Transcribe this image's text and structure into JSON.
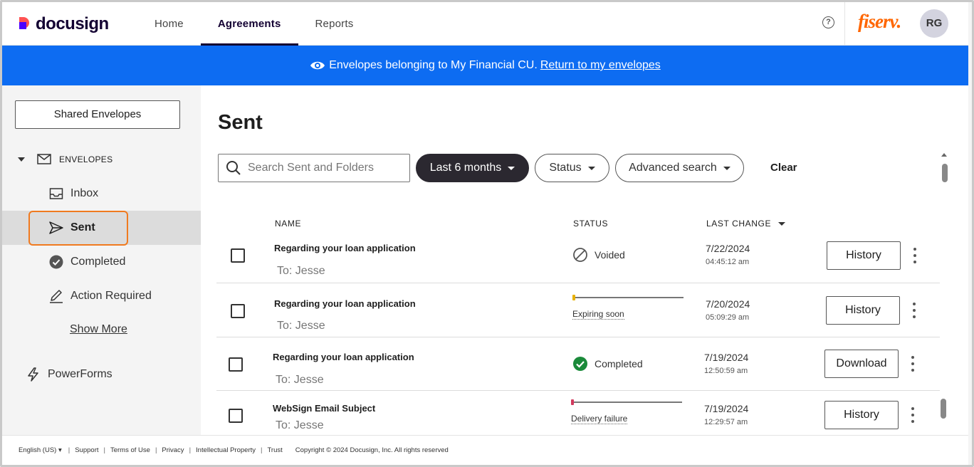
{
  "header": {
    "logo": "docusign",
    "nav": [
      "Home",
      "Agreements",
      "Reports"
    ],
    "active_nav": "Agreements",
    "brand": "fiserv.",
    "avatar": "RG",
    "help": "?"
  },
  "banner": {
    "text": "Envelopes belonging to My Financial CU.",
    "link": "Return to my envelopes"
  },
  "sidebar": {
    "shared_button": "Shared Envelopes",
    "section": "ENVELOPES",
    "items": [
      {
        "label": "Inbox",
        "icon": "inbox-icon"
      },
      {
        "label": "Sent",
        "icon": "send-icon"
      },
      {
        "label": "Completed",
        "icon": "check-circle-icon"
      },
      {
        "label": "Action Required",
        "icon": "pen-icon"
      }
    ],
    "show_more": "Show More",
    "powerforms": "PowerForms"
  },
  "main": {
    "title": "Sent",
    "search_placeholder": "Search Sent and Folders",
    "filters": {
      "date": "Last 6 months",
      "status": "Status",
      "advanced": "Advanced search",
      "clear": "Clear"
    },
    "columns": {
      "name": "NAME",
      "status": "STATUS",
      "last_change": "LAST CHANGE"
    },
    "rows": [
      {
        "subject": "Regarding your loan application",
        "to": "To: Jesse",
        "status": "Voided",
        "date": "7/22/2024",
        "time": "04:45:12 am",
        "action": "History"
      },
      {
        "subject": "Regarding your loan application",
        "to": "To: Jesse",
        "status": "Expiring soon",
        "date": "7/20/2024",
        "time": "05:09:29 am",
        "action": "History"
      },
      {
        "subject": "Regarding your loan application",
        "to": "To: Jesse",
        "status": "Completed",
        "date": "7/19/2024",
        "time": "12:50:59 am",
        "action": "Download"
      },
      {
        "subject": "WebSign Email Subject",
        "to": "To: Jesse",
        "status": "Delivery failure",
        "date": "7/19/2024",
        "time": "12:29:57 am",
        "action": "History"
      }
    ]
  },
  "footer": {
    "language": "English (US)",
    "links": [
      "Support",
      "Terms of Use",
      "Privacy",
      "Intellectual Property",
      "Trust"
    ],
    "copyright": "Copyright © 2024 Docusign, Inc. All rights reserved"
  },
  "colors": {
    "banner": "#0d6cf2",
    "highlight": "#f07a1f",
    "brand": "#ff6600",
    "completed": "#1a8a3a",
    "expiring": "#e8b100",
    "failure": "#d23a5e"
  }
}
